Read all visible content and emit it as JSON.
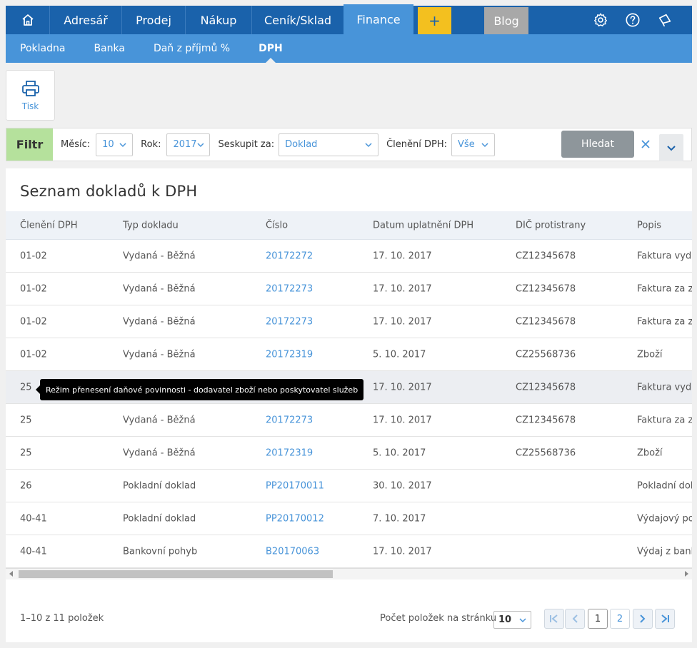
{
  "nav": {
    "tabs": [
      "Adresář",
      "Prodej",
      "Nákup",
      "Ceník/Sklad"
    ],
    "active_tab": "Finance",
    "plus": "+",
    "blog": "Blog"
  },
  "subnav": [
    "Pokladna",
    "Banka",
    "Daň z příjmů %",
    "DPH"
  ],
  "toolbar": {
    "print_label": "Tisk"
  },
  "filter": {
    "label": "Filtr",
    "month_label": "Měsíc:",
    "month_value": "10",
    "year_label": "Rok:",
    "year_value": "2017",
    "group_label": "Seskupit za:",
    "group_value": "Doklad",
    "vat_label": "Členění DPH:",
    "vat_value": "Vše",
    "search_label": "Hledat"
  },
  "table": {
    "title": "Seznam dokladů k DPH",
    "headers": [
      "Členění DPH",
      "Typ dokladu",
      "Číslo",
      "Datum uplatnění DPH",
      "DIČ protistrany",
      "Popis"
    ],
    "rows": [
      [
        "01-02",
        "Vydaná - Běžná",
        "20172272",
        "17. 10. 2017",
        "CZ12345678",
        "Faktura vydan"
      ],
      [
        "01-02",
        "Vydaná - Běžná",
        "20172273",
        "17. 10. 2017",
        "CZ12345678",
        "Faktura za zbo"
      ],
      [
        "01-02",
        "Vydaná - Běžná",
        "20172273",
        "17. 10. 2017",
        "CZ12345678",
        "Faktura za zbo"
      ],
      [
        "01-02",
        "Vydaná - Běžná",
        "20172319",
        "5. 10. 2017",
        "CZ25568736",
        "Zboží"
      ],
      [
        "25",
        "",
        "",
        "17. 10. 2017",
        "CZ12345678",
        "Faktura vydan"
      ],
      [
        "25",
        "Vydaná - Běžná",
        "20172273",
        "17. 10. 2017",
        "CZ12345678",
        "Faktura za zbo"
      ],
      [
        "25",
        "Vydaná - Běžná",
        "20172319",
        "5. 10. 2017",
        "CZ25568736",
        "Zboží"
      ],
      [
        "26",
        "Pokladní doklad",
        "PP20170011",
        "30. 10. 2017",
        "",
        "Pokladní dokl"
      ],
      [
        "40-41",
        "Pokladní doklad",
        "PP20170012",
        "7. 10. 2017",
        "",
        "Výdajový pok"
      ],
      [
        "40-41",
        "Bankovní pohyb",
        "B20170063",
        "17. 10. 2017",
        "",
        "Výdaj z banky"
      ]
    ],
    "tooltip": "Režim přenesení daňové povinnosti - dodavatel zboží nebo poskytovatel služeb"
  },
  "pagination": {
    "count_text": "1–10 z 11 položek",
    "per_page_label": "Počet položek na stránku",
    "per_page_value": "10",
    "pages": [
      "1",
      "2"
    ],
    "current_page": "1"
  }
}
